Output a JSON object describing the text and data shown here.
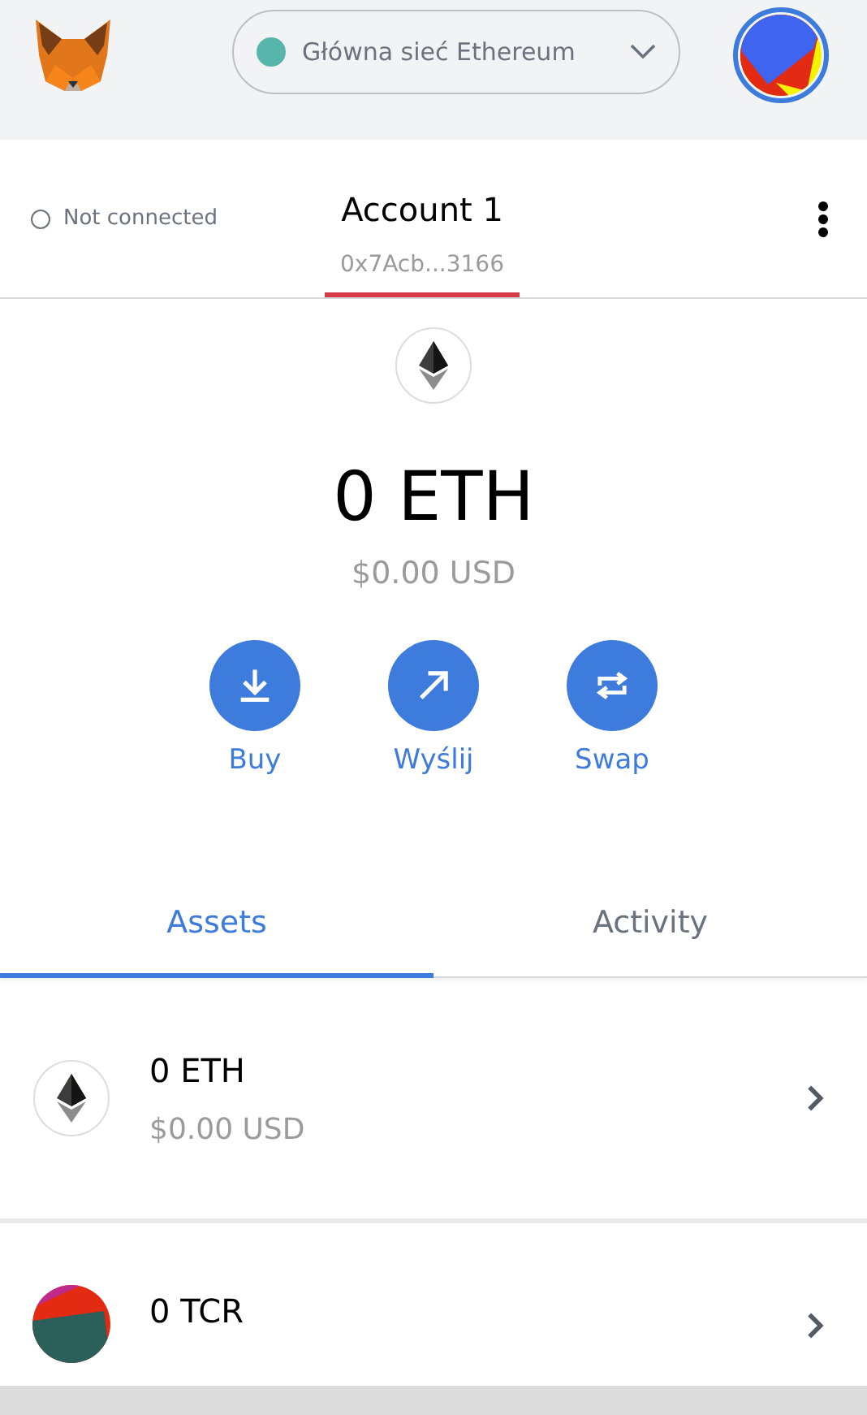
{
  "network": {
    "name": "Główna sieć Ethereum",
    "color": "#56b6ac"
  },
  "account": {
    "status": "Not connected",
    "connected": false,
    "name": "Account 1",
    "address": "0x7Acb...3166"
  },
  "balance": {
    "amount": "0 ETH",
    "fiat": "$0.00 USD"
  },
  "actions": [
    {
      "kind": "buy",
      "label": "Buy"
    },
    {
      "kind": "send",
      "label": "Wyślij"
    },
    {
      "kind": "swap",
      "label": "Swap"
    }
  ],
  "tabs": [
    {
      "label": "Assets",
      "selected": true
    },
    {
      "label": "Activity",
      "selected": false
    }
  ],
  "assets": [
    {
      "kind": "eth",
      "amount": "0 ETH",
      "fiat": "$0.00 USD"
    },
    {
      "kind": "token",
      "amount": "0 TCR"
    }
  ]
}
